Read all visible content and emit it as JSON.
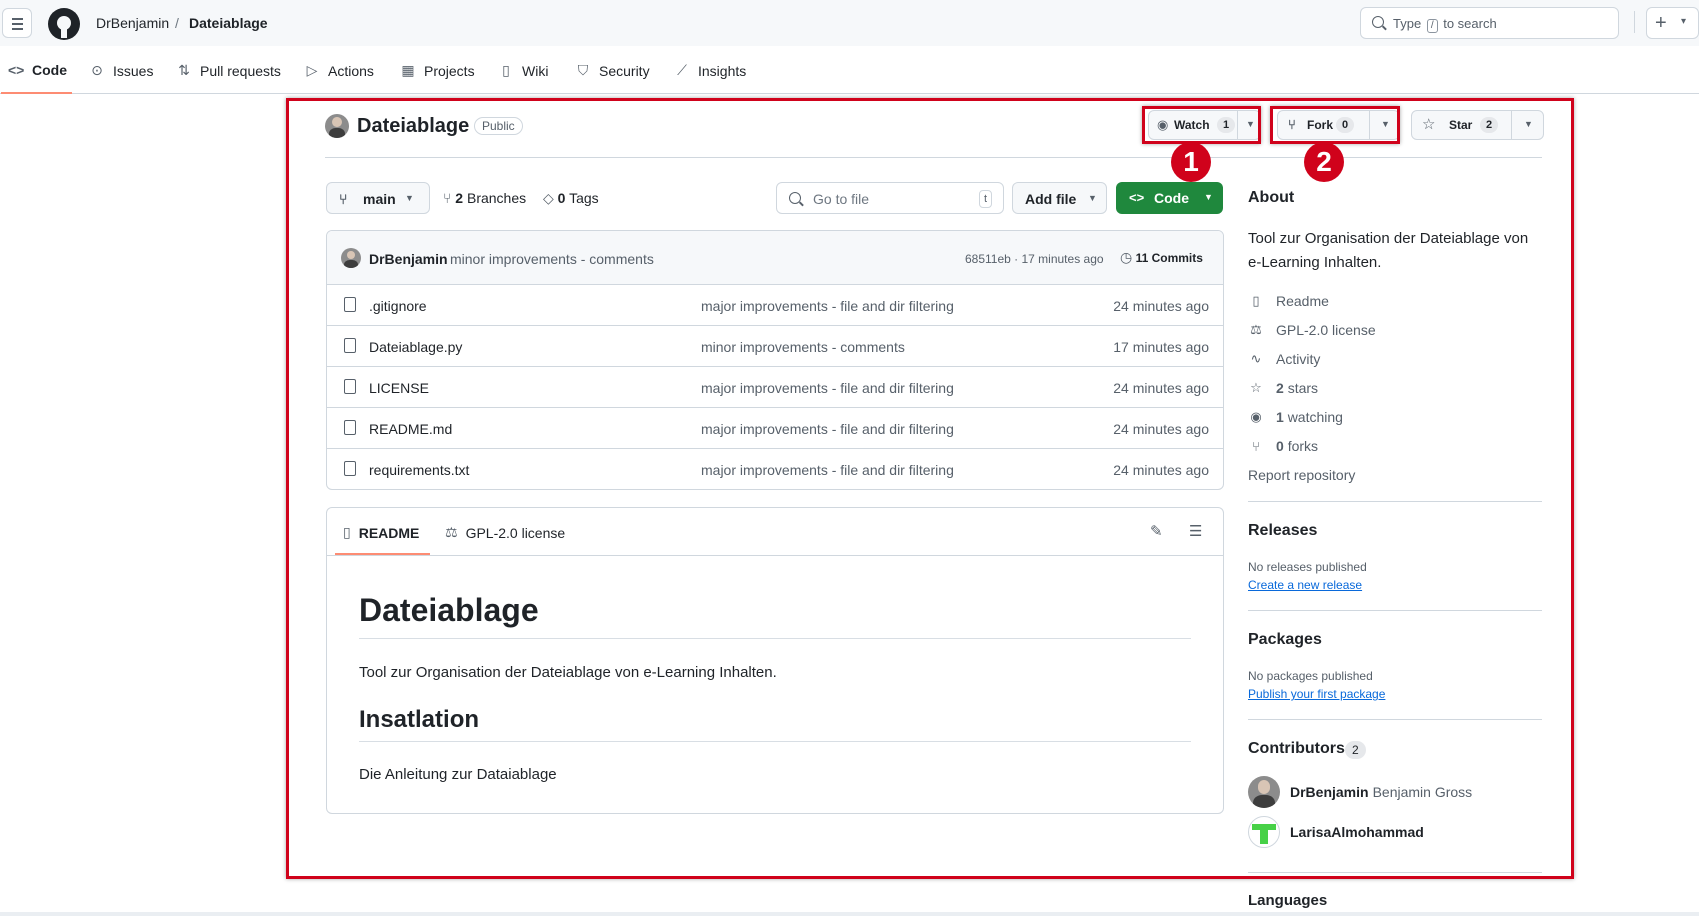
{
  "header": {
    "owner": "DrBenjamin",
    "separator": "/",
    "repo": "Dateiablage",
    "search_before": "Type",
    "search_key": "/",
    "search_after": "to search",
    "new_symbol": "+",
    "new_caret": "▾"
  },
  "nav": {
    "tabs": [
      {
        "label": "Code",
        "icon": "code-icon"
      },
      {
        "label": "Issues",
        "icon": "issue-icon"
      },
      {
        "label": "Pull requests",
        "icon": "pull-request-icon"
      },
      {
        "label": "Actions",
        "icon": "play-icon"
      },
      {
        "label": "Projects",
        "icon": "table-icon"
      },
      {
        "label": "Wiki",
        "icon": "book-icon"
      },
      {
        "label": "Security",
        "icon": "shield-icon"
      },
      {
        "label": "Insights",
        "icon": "graph-icon"
      }
    ]
  },
  "repo": {
    "name": "Dateiablage",
    "visibility": "Public",
    "watch_label": "Watch",
    "watch_count": "1",
    "fork_label": "Fork",
    "fork_count": "0",
    "star_label": "Star",
    "star_count": "2"
  },
  "annotations": {
    "marker1": "1",
    "marker2": "2",
    "highlight_color": "#d0021b"
  },
  "files_toolbar": {
    "branch": "main",
    "branches_count": "2",
    "branches_label": "Branches",
    "tags_count": "0",
    "tags_label": "Tags",
    "goto_placeholder": "Go to file",
    "goto_key": "t",
    "add_file": "Add file",
    "code_button": "Code"
  },
  "latest_commit": {
    "author": "DrBenjamin",
    "message": "minor improvements - comments",
    "meta": "68511eb · 17 minutes ago",
    "commits_count": "11",
    "commits_label": "Commits"
  },
  "files": [
    {
      "name": ".gitignore",
      "message": "major improvements - file and dir filtering",
      "age": "24 minutes ago"
    },
    {
      "name": "Dateiablage.py",
      "message": "minor improvements - comments",
      "age": "17 minutes ago"
    },
    {
      "name": "LICENSE",
      "message": "major improvements - file and dir filtering",
      "age": "24 minutes ago"
    },
    {
      "name": "README.md",
      "message": "major improvements - file and dir filtering",
      "age": "24 minutes ago"
    },
    {
      "name": "requirements.txt",
      "message": "major improvements - file and dir filtering",
      "age": "24 minutes ago"
    }
  ],
  "readme": {
    "tab_readme": "README",
    "tab_license": "GPL-2.0 license",
    "h1": "Dateiablage",
    "p1": "Tool zur Organisation der Dateiablage von e-Learning Inhalten.",
    "h2": "Insatlation",
    "p2": "Die Anleitung zur Dataiablage"
  },
  "sidebar": {
    "about_title": "About",
    "description": "Tool zur Organisation der Dateiablage von e-Learning Inhalten.",
    "items": [
      {
        "icon": "book-icon",
        "bold": "",
        "label": "Readme"
      },
      {
        "icon": "law-icon",
        "bold": "",
        "label": "GPL-2.0 license"
      },
      {
        "icon": "pulse-icon",
        "bold": "",
        "label": "Activity"
      },
      {
        "icon": "star-icon",
        "bold": "2",
        "label": "stars"
      },
      {
        "icon": "eye-icon",
        "bold": "1",
        "label": "watching"
      },
      {
        "icon": "fork-icon",
        "bold": "0",
        "label": "forks"
      }
    ],
    "report": "Report repository",
    "releases_title": "Releases",
    "releases_none": "No releases published",
    "releases_link": "Create a new release",
    "packages_title": "Packages",
    "packages_none": "No packages published",
    "packages_link": "Publish your first package",
    "contributors_title": "Contributors",
    "contributors_count": "2",
    "contributors": [
      {
        "login": "DrBenjamin",
        "name": "Benjamin Gross"
      },
      {
        "login": "LarisaAlmohammad",
        "name": ""
      }
    ],
    "languages_title": "Languages"
  }
}
